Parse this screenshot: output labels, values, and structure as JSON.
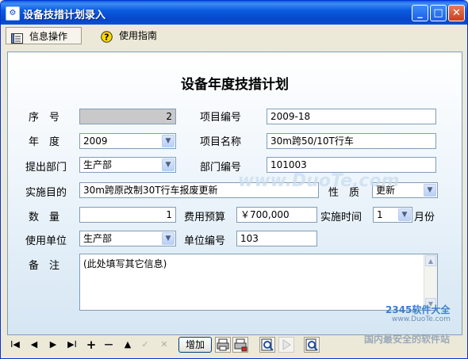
{
  "window": {
    "title": "设备技措计划录入",
    "min": "_",
    "max": "□",
    "close": "✕"
  },
  "menu": {
    "items": [
      {
        "label": "信息操作"
      },
      {
        "label": "使用指南"
      }
    ]
  },
  "form": {
    "title": "设备年度技措计划",
    "seq": {
      "label": "序　号",
      "value": "2"
    },
    "year": {
      "label": "年　度",
      "value": "2009"
    },
    "dept": {
      "label": "提出部门",
      "value": "生产部"
    },
    "purpose": {
      "label": "实施目的",
      "value": "30m跨原改制30T行车报废更新"
    },
    "quantity": {
      "label": "数　量",
      "value": "1"
    },
    "user_unit": {
      "label": "使用单位",
      "value": "生产部"
    },
    "remark": {
      "label": "备　注",
      "value": "(此处填写其它信息)"
    },
    "project_no": {
      "label": "项目编号",
      "value": "2009-18"
    },
    "project_name": {
      "label": "项目名称",
      "value": "30m跨50/10T行车"
    },
    "dept_no": {
      "label": "部门编号",
      "value": "101003"
    },
    "nature": {
      "label": "性　质",
      "value": "更新"
    },
    "budget": {
      "label": "费用预算",
      "value": "￥700,000"
    },
    "time": {
      "label": "实施时间",
      "value": "1",
      "unit": "月份"
    },
    "unit_no": {
      "label": "单位编号",
      "value": "103"
    }
  },
  "nav": {
    "first": "I◀",
    "prev": "◀",
    "next": "▶",
    "last": "▶I",
    "insert": "+",
    "delete": "—",
    "edit": "▲",
    "post": "✓",
    "cancel": "✕",
    "add_label": "增加"
  },
  "watermark": {
    "site": "www.DuoTe.com",
    "logo_text": "2345软件大全",
    "logo_url": "www.DuoTe.com",
    "slogan": "国内最安全的软件站"
  },
  "colors": {
    "titlebar": "#0a5ce0",
    "accent": "#0831d9"
  }
}
